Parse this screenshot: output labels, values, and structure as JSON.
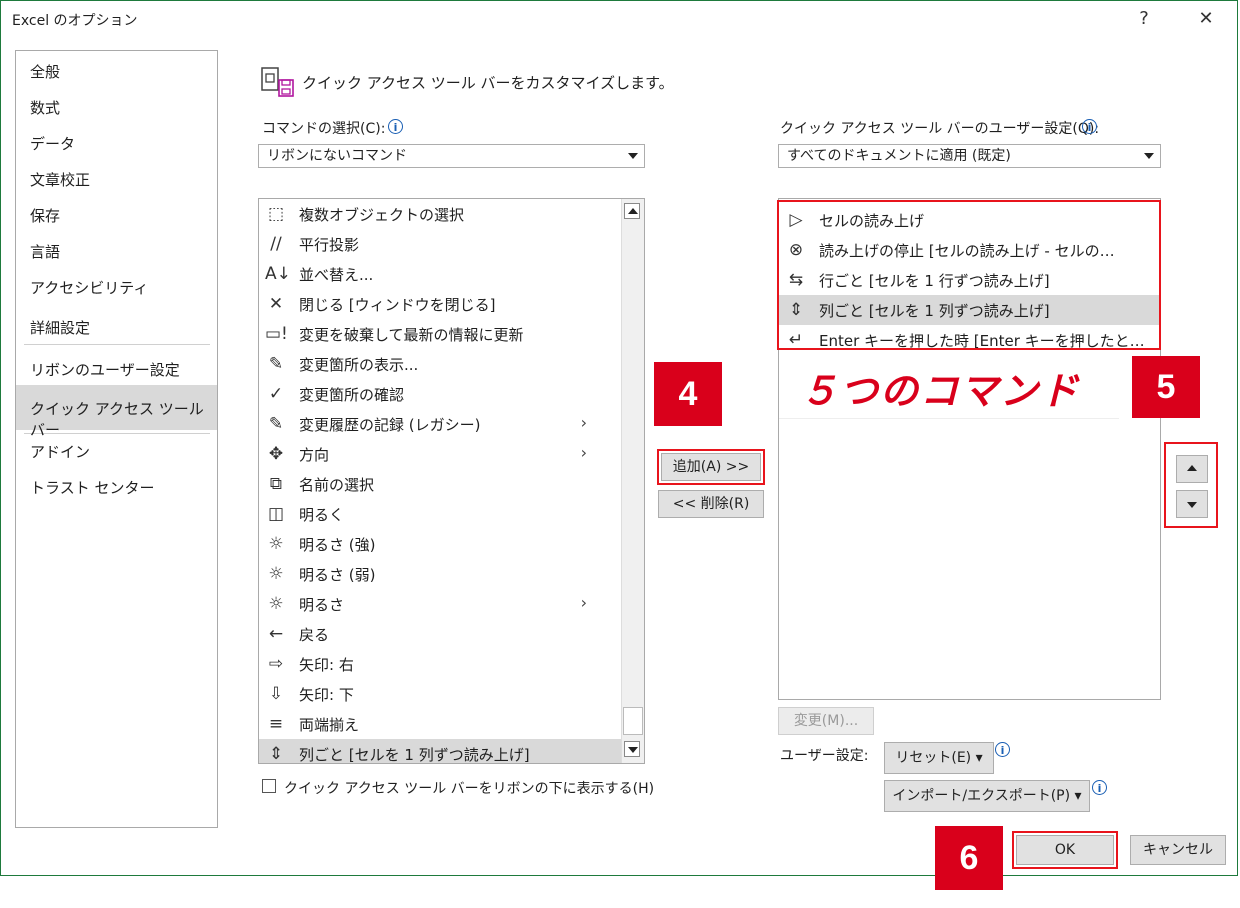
{
  "window": {
    "title": "Excel のオプション",
    "help": "?",
    "close": "✕"
  },
  "sidebar": {
    "items": [
      {
        "label": "全般"
      },
      {
        "label": "数式"
      },
      {
        "label": "データ"
      },
      {
        "label": "文章校正"
      },
      {
        "label": "保存"
      },
      {
        "label": "言語"
      },
      {
        "label": "アクセシビリティ"
      },
      {
        "label": "詳細設定"
      },
      {
        "label": "リボンのユーザー設定"
      },
      {
        "label": "クイック アクセス ツール バー",
        "selected": true
      },
      {
        "label": "アドイン"
      },
      {
        "label": "トラスト センター"
      }
    ]
  },
  "header": {
    "text": "クイック アクセス ツール バーをカスタマイズします。"
  },
  "left": {
    "choose_label": "コマンドの選択(C):",
    "choose_value": "リボンにないコマンド",
    "commands": [
      {
        "icon": "select-objects-icon",
        "glyph": "⬚",
        "label": "複数オブジェクトの選択"
      },
      {
        "icon": "parallel-projection-icon",
        "glyph": "∕∕",
        "label": "平行投影"
      },
      {
        "icon": "sort-icon",
        "glyph": "A↓",
        "label": "並べ替え..."
      },
      {
        "icon": "close-x-icon",
        "glyph": "✕",
        "label": "閉じる [ウィンドウを閉じる]"
      },
      {
        "icon": "discard-refresh-icon",
        "glyph": "▭!",
        "label": "変更を破棄して最新の情報に更新"
      },
      {
        "icon": "show-changes-icon",
        "glyph": "✎",
        "label": "変更箇所の表示..."
      },
      {
        "icon": "accept-changes-icon",
        "glyph": "✓",
        "label": "変更箇所の確認"
      },
      {
        "icon": "track-changes-icon",
        "glyph": "✎",
        "label": "変更履歴の記録 (レガシー)",
        "submenu": true
      },
      {
        "icon": "direction-icon",
        "glyph": "✥",
        "label": "方向",
        "submenu": true
      },
      {
        "icon": "select-name-icon",
        "glyph": "⧉",
        "label": "名前の選択"
      },
      {
        "icon": "bright-cube-icon",
        "glyph": "◫",
        "label": "明るく"
      },
      {
        "icon": "brightness-up-icon",
        "glyph": "☼",
        "label": "明るさ (強)"
      },
      {
        "icon": "brightness-down-icon",
        "glyph": "☼",
        "label": "明るさ (弱)"
      },
      {
        "icon": "brightness-icon",
        "glyph": "☼",
        "label": "明るさ",
        "submenu": true
      },
      {
        "icon": "back-arrow-icon",
        "glyph": "←",
        "label": "戻る"
      },
      {
        "icon": "arrow-right-icon",
        "glyph": "⇨",
        "label": "矢印: 右"
      },
      {
        "icon": "arrow-down-icon",
        "glyph": "⇩",
        "label": "矢印: 下"
      },
      {
        "icon": "justify-icon",
        "glyph": "≡",
        "label": "両端揃え"
      },
      {
        "icon": "read-by-columns-icon",
        "glyph": "⇕",
        "label": "列ごと [セルを 1 列ずつ読み上げ]",
        "selected": true
      }
    ],
    "show_below_label": "クイック アクセス ツール バーをリボンの下に表示する(H)"
  },
  "middle": {
    "add_label": "追加(A) >>",
    "remove_label": "<< 削除(R)"
  },
  "right": {
    "customize_label": "クイック アクセス ツール バーのユーザー設定(Q):",
    "customize_value": "すべてのドキュメントに適用 (既定)",
    "items": [
      {
        "icon": "speak-cells-icon",
        "glyph": "▷",
        "label": "セルの読み上げ"
      },
      {
        "icon": "stop-speaking-icon",
        "glyph": "⊗",
        "label": "読み上げの停止 [セルの読み上げ - セルの…"
      },
      {
        "icon": "read-by-rows-icon",
        "glyph": "⇆",
        "label": "行ごと [セルを 1 行ずつ読み上げ]"
      },
      {
        "icon": "read-by-columns-icon",
        "glyph": "⇕",
        "label": "列ごと [セルを 1 列ずつ読み上げ]",
        "selected": true
      },
      {
        "icon": "speak-on-enter-icon",
        "glyph": "↵",
        "label": "Enter キーを押した時 [Enter キーを押したと…"
      }
    ],
    "modify_label": "変更(M)...",
    "user_setting_label": "ユーザー設定:",
    "reset_label": "リセット(E) ▾",
    "import_export_label": "インポート/エクスポート(P) ▾"
  },
  "footer": {
    "ok_label": "OK",
    "cancel_label": "キャンセル"
  },
  "annotations": {
    "badge4": "4",
    "badge5": "5",
    "badge6": "6",
    "callout": "５つのコマンド"
  },
  "colors": {
    "accent_red": "#d9001b",
    "selection": "#d9d9d9"
  }
}
